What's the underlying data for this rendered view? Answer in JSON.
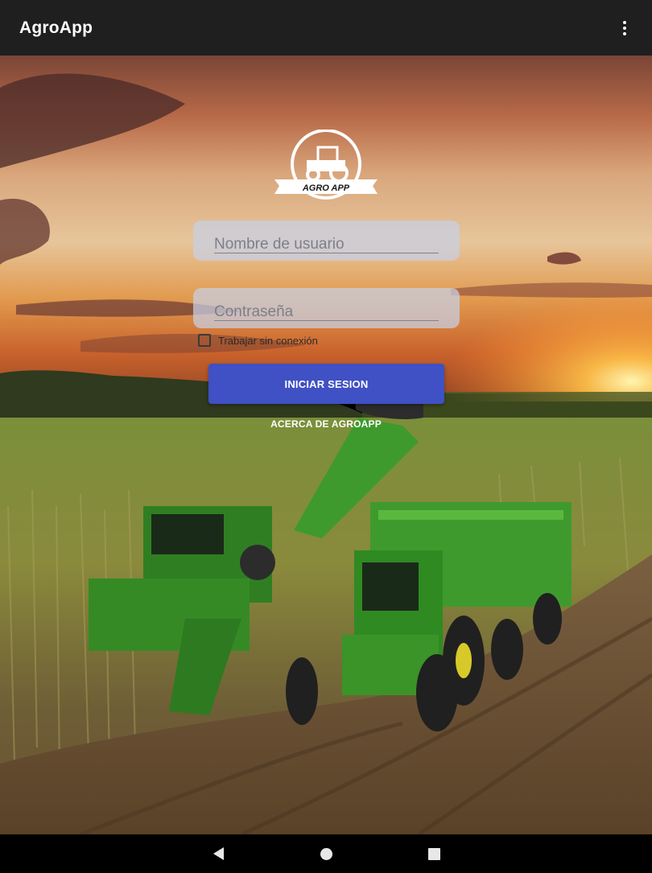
{
  "app": {
    "title": "AgroApp"
  },
  "logo": {
    "text": "AGRO APP"
  },
  "form": {
    "username_placeholder": "Nombre de usuario",
    "username_value": "",
    "password_placeholder": "Contraseña",
    "password_value": "",
    "offline_label": "Trabajar sin conexión",
    "offline_checked": false,
    "login_label": "INICIAR SESION",
    "about_label": "ACERCA DE AGROAPP"
  },
  "colors": {
    "appbar": "#1f1f1f",
    "primary_button": "#3f51c4",
    "field_background": "#c8d0e6",
    "tractor_green": "#3f8f2a"
  },
  "icons": {
    "overflow": "more-vert-icon",
    "logo": "tractor-icon",
    "back": "back-icon",
    "home": "home-icon",
    "recents": "recents-icon"
  }
}
